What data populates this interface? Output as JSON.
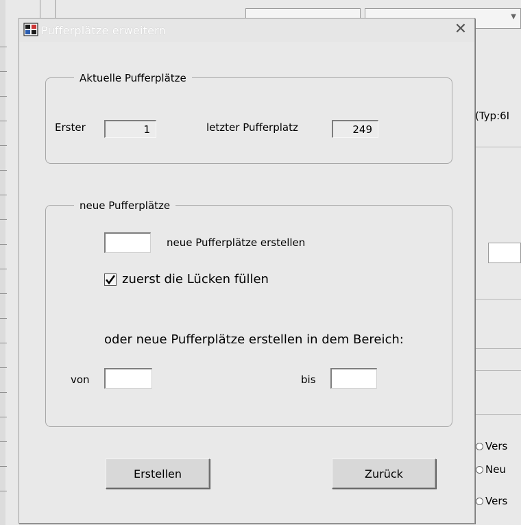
{
  "background": {
    "right_texts": {
      "typ": "(Typ:6I",
      "radio_1": "Vers",
      "radio_2": "Neu",
      "radio_3": "Vers"
    }
  },
  "dialog": {
    "title": "Pufferplätze erweitern",
    "close_glyph": "✕",
    "current_group": {
      "label": "Aktuelle Pufferplätze",
      "first_label": "Erster",
      "first_value": "1",
      "last_label": "letzter Pufferplatz",
      "last_value": "249"
    },
    "new_group": {
      "label": "neue Pufferplätze",
      "count_value": "",
      "count_label": "neue Pufferplätze erstellen",
      "fill_gaps_label": "zuerst die Lücken füllen",
      "fill_gaps_checked": true,
      "range_heading": "oder neue Pufferplätze erstellen in dem Bereich:",
      "from_label": "von",
      "from_value": "",
      "to_label": "bis",
      "to_value": ""
    },
    "buttons": {
      "create_label": "Erstellen",
      "back_label": "Zurück"
    }
  },
  "colors": {
    "dialog_bg": "#e9e9e9",
    "title_text": "#ffffff",
    "border": "#a8a8a8"
  }
}
